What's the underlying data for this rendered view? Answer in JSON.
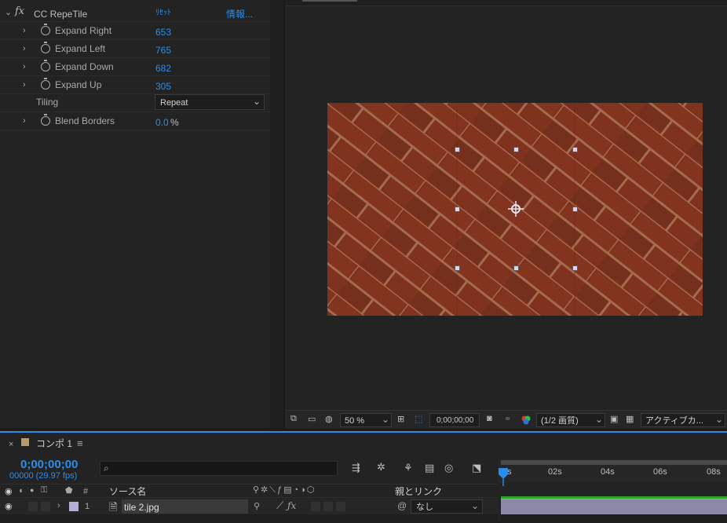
{
  "effect": {
    "fx_label": "fx",
    "name": "CC RepeTile",
    "reset_label": "ﾘｾｯﾄ",
    "info_label": "情報...",
    "params": [
      {
        "label": "Expand Right",
        "value": "653"
      },
      {
        "label": "Expand Left",
        "value": "765"
      },
      {
        "label": "Expand Down",
        "value": "682"
      },
      {
        "label": "Expand Up",
        "value": "305"
      }
    ],
    "tiling": {
      "label": "Tiling",
      "value": "Repeat"
    },
    "blend": {
      "label": "Blend Borders",
      "value": "0.0",
      "unit": "%"
    }
  },
  "viewer": {
    "zoom": "50 %",
    "timecode": "0;00;00;00",
    "resolution": "(1/2 画質)",
    "camera": "アクティブカ..."
  },
  "timeline": {
    "close": "×",
    "comp_name": "コンポ 1",
    "menu": "≡",
    "current_time": "0;00;00;00",
    "frame_info": "00000 (29.97 fps)",
    "search_placeholder": "",
    "col_hash": "#",
    "col_source": "ソース名",
    "col_parent": "親とリンク",
    "layer": {
      "number": "1",
      "name": "tile 2.jpg",
      "parent": "なし"
    },
    "ruler": [
      "0s",
      "02s",
      "04s",
      "06s",
      "08s"
    ]
  },
  "colors": {
    "accent": "#2d8ceb",
    "brick": "#7a2f1c",
    "layer_bar": "#8d88a6",
    "work_area": "#2aa52a"
  }
}
